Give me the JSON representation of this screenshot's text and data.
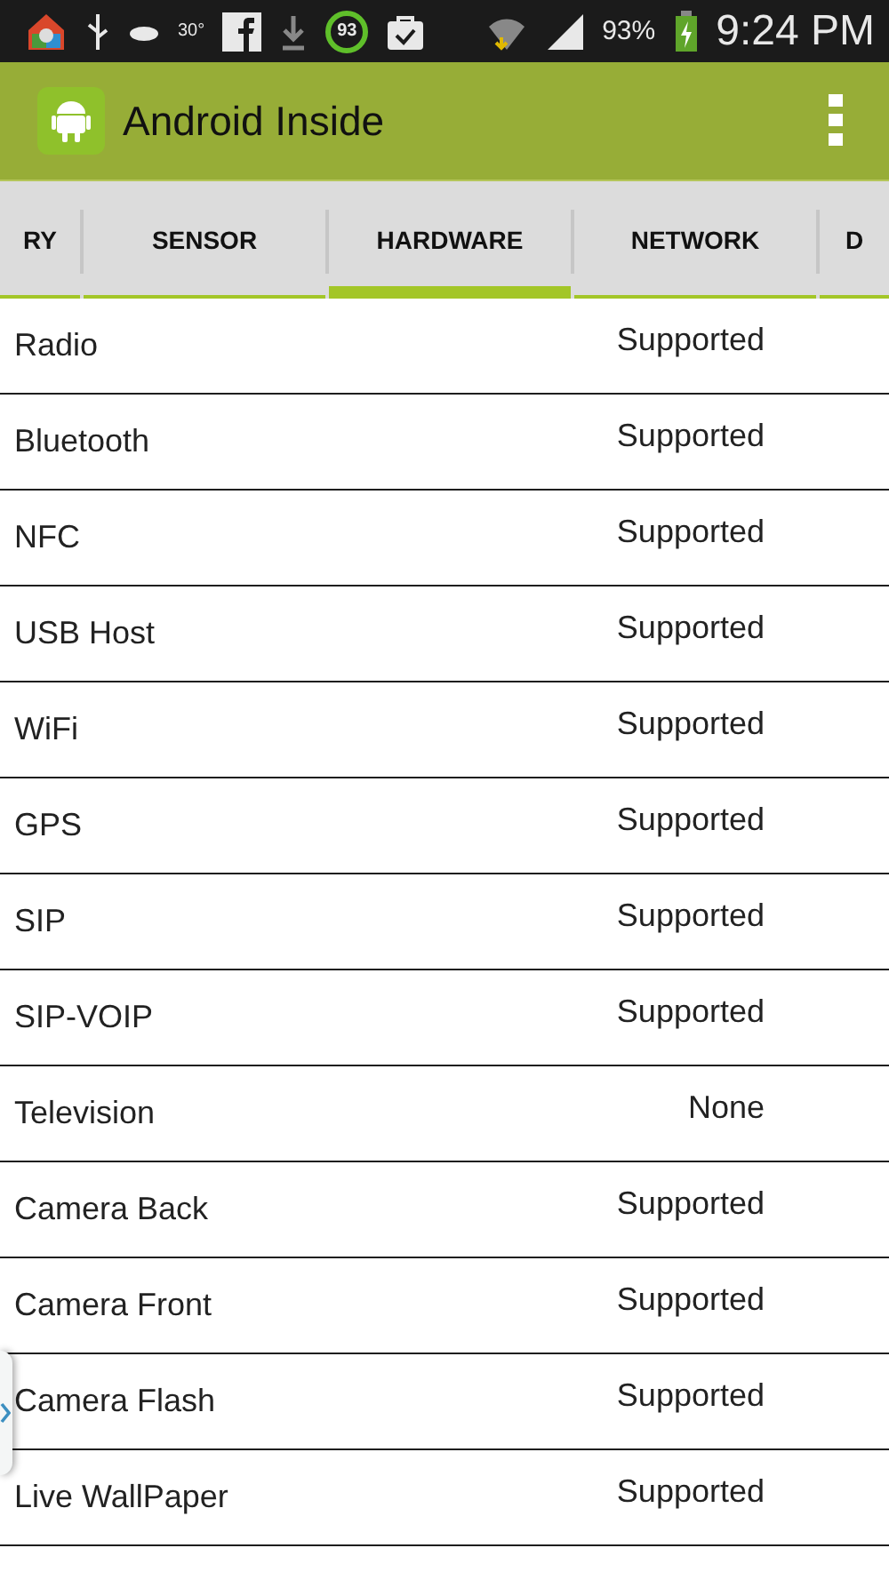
{
  "status_bar": {
    "weather_temp": "30°",
    "ring_value": "93",
    "battery_percent": "93%",
    "time": "9:24 PM"
  },
  "app_bar": {
    "title": "Android Inside"
  },
  "tabs": [
    {
      "label": "RY",
      "selected": false
    },
    {
      "label": "SENSOR",
      "selected": false
    },
    {
      "label": "HARDWARE",
      "selected": true
    },
    {
      "label": "NETWORK",
      "selected": false
    },
    {
      "label": "D",
      "selected": false
    }
  ],
  "rows": [
    {
      "name": "Radio",
      "value": "Supported"
    },
    {
      "name": "Bluetooth",
      "value": "Supported"
    },
    {
      "name": "NFC",
      "value": "Supported"
    },
    {
      "name": "USB Host",
      "value": "Supported"
    },
    {
      "name": "WiFi",
      "value": "Supported"
    },
    {
      "name": "GPS",
      "value": "Supported"
    },
    {
      "name": "SIP",
      "value": "Supported"
    },
    {
      "name": "SIP-VOIP",
      "value": "Supported"
    },
    {
      "name": "Television",
      "value": "None"
    },
    {
      "name": "Camera Back",
      "value": "Supported"
    },
    {
      "name": "Camera Front",
      "value": "Supported"
    },
    {
      "name": "Camera Flash",
      "value": "Supported"
    },
    {
      "name": "Live WallPaper",
      "value": "Supported"
    }
  ]
}
